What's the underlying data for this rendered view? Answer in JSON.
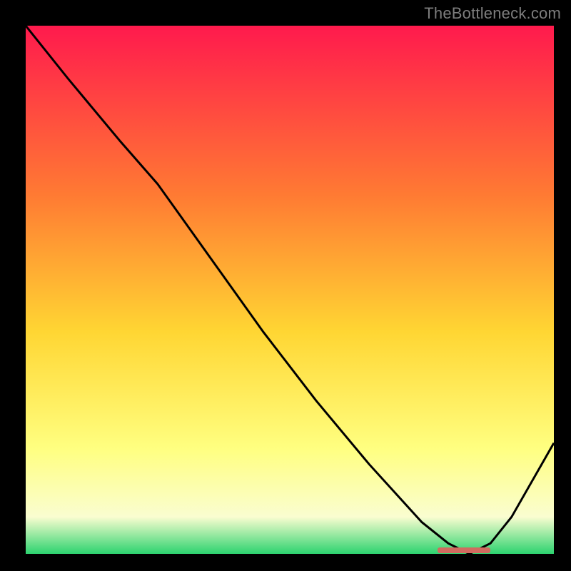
{
  "attribution": {
    "watermark": "TheBottleneck.com"
  },
  "colors": {
    "bg_black": "#000000",
    "grad_top": "#ff1a4d",
    "grad_mid1": "#ff7a33",
    "grad_mid2": "#ffd633",
    "grad_mid3": "#ffff80",
    "grad_mid4": "#fafdd0",
    "grad_bottom": "#2dd36f",
    "line": "#000000",
    "marker": "#d16a5f",
    "watermark": "#7d7d7d"
  },
  "chart_data": {
    "type": "line",
    "title": "",
    "xlabel": "",
    "ylabel": "",
    "xlim": [
      0,
      100
    ],
    "ylim": [
      0,
      100
    ],
    "notes": "Vertical gradient red→orange→yellow→pale→green inside a black frame; a black curve descends from top-left, goes nearly linear downward to a minimum around x≈83, then rises toward the right edge. A small salmon horizontal marker sits at the curve's minimum along the bottom.",
    "series": [
      {
        "name": "curve",
        "x": [
          0,
          8,
          18,
          25,
          35,
          45,
          55,
          65,
          75,
          80,
          84,
          88,
          92,
          100
        ],
        "y": [
          100,
          90,
          78,
          70,
          56,
          42,
          29,
          17,
          6,
          2,
          0,
          2,
          7,
          21
        ]
      }
    ],
    "marker": {
      "x_start": 78,
      "x_end": 88,
      "y": 0
    }
  }
}
